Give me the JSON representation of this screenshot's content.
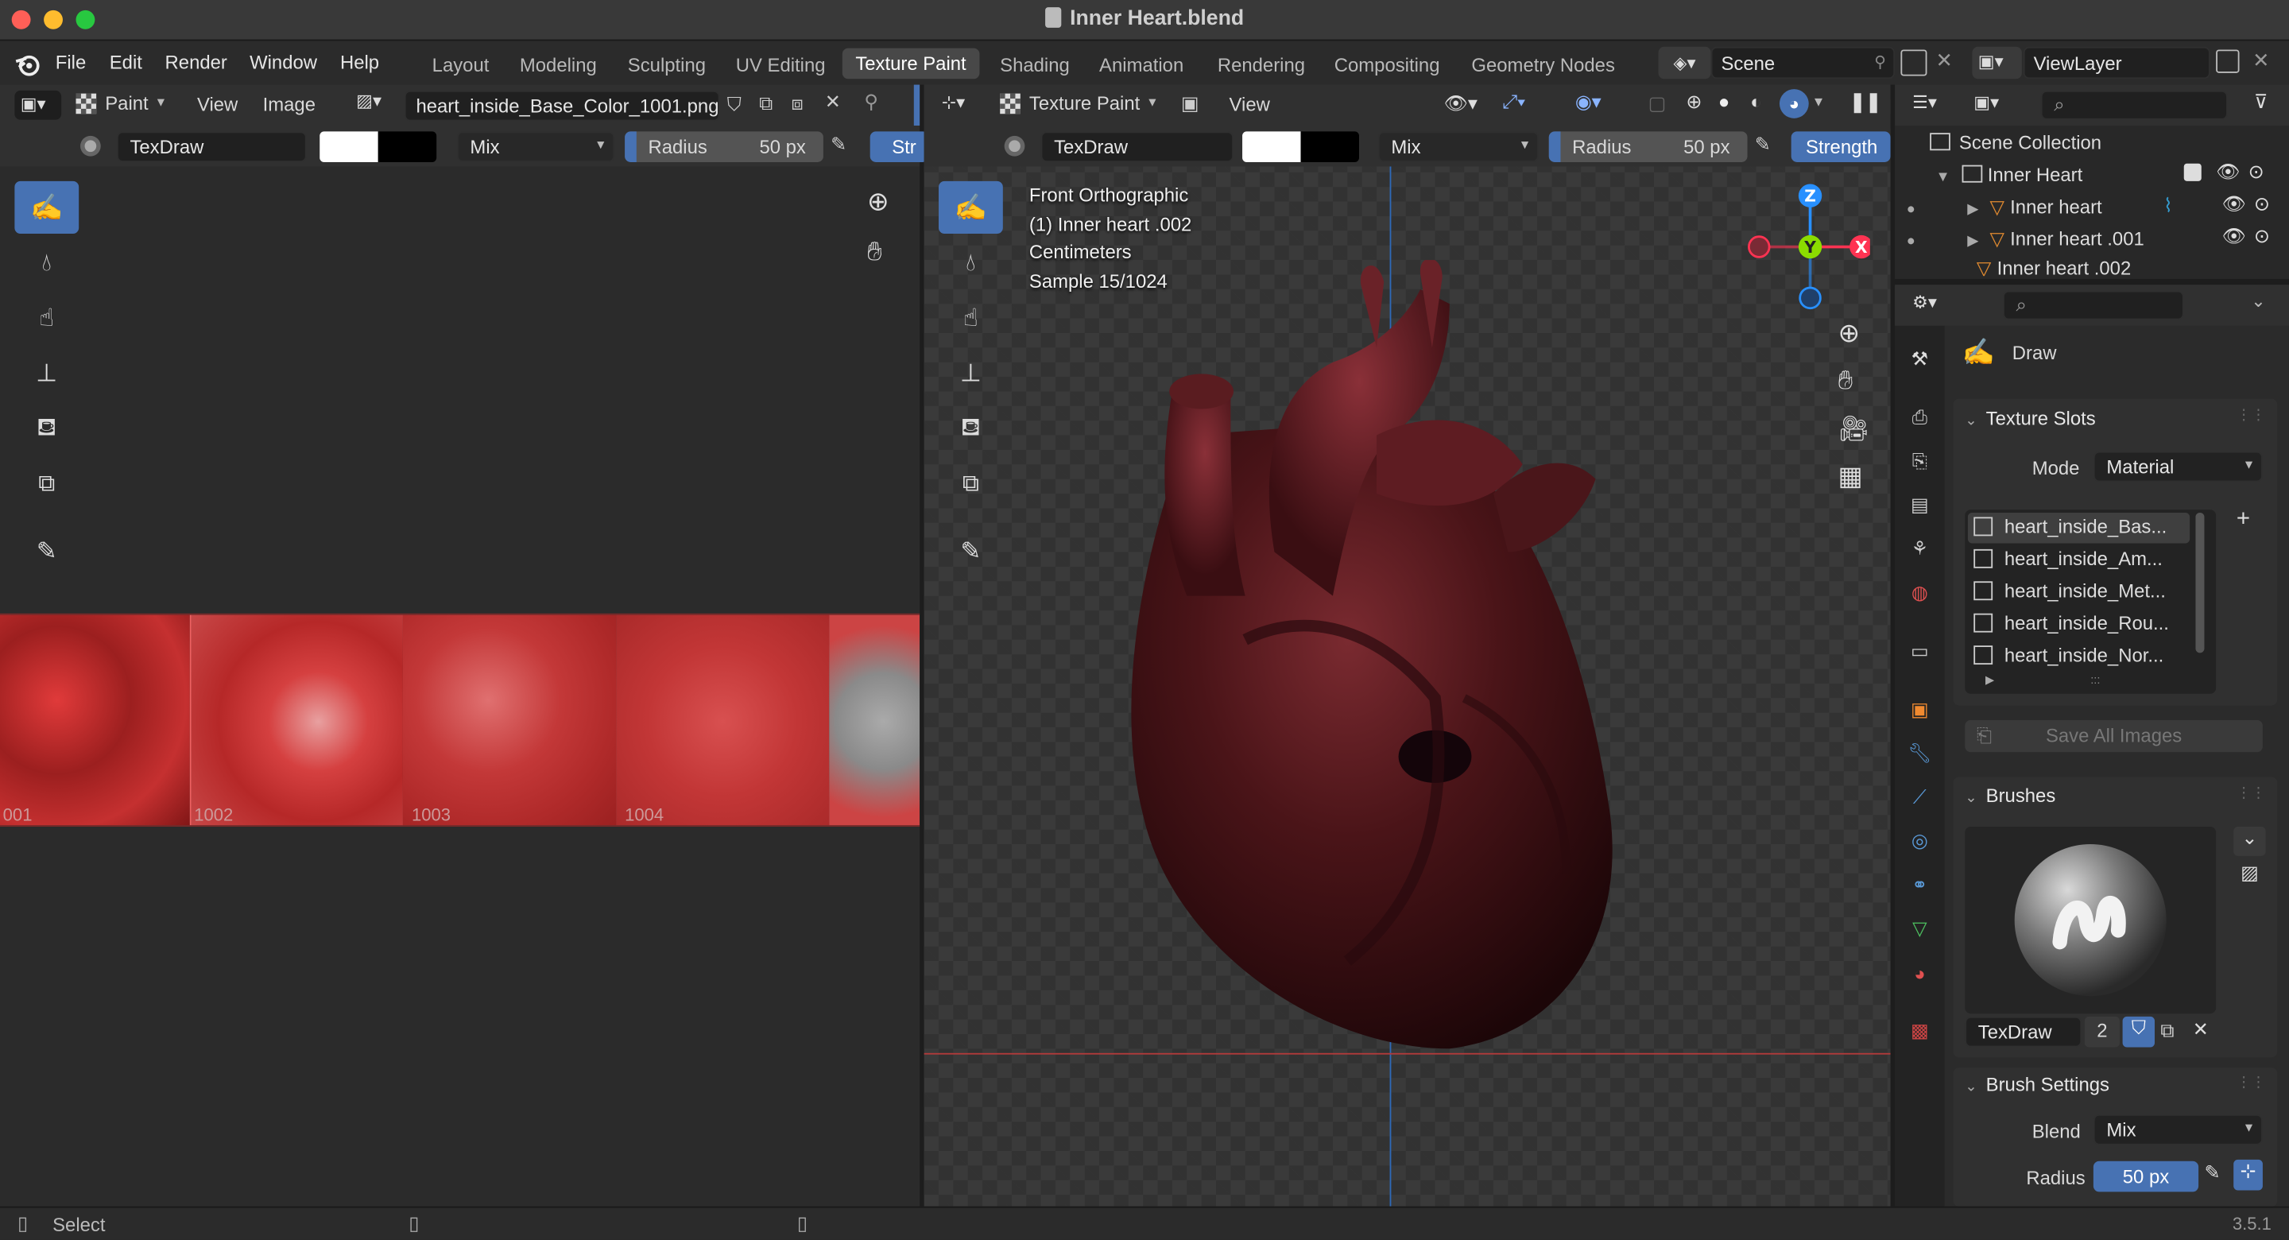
{
  "window": {
    "title": "Inner Heart.blend"
  },
  "menu": [
    "File",
    "Edit",
    "Render",
    "Window",
    "Help"
  ],
  "workspaces": [
    "Layout",
    "Modeling",
    "Sculpting",
    "UV Editing",
    "Texture Paint",
    "Shading",
    "Animation",
    "Rendering",
    "Compositing",
    "Geometry Nodes"
  ],
  "active_workspace": "Texture Paint",
  "scene": {
    "name": "Scene",
    "view_layer": "ViewLayer"
  },
  "image_editor": {
    "mode": "Paint",
    "menus": [
      "View",
      "Image"
    ],
    "image_name": "heart_inside_Base_Color_1001.png",
    "tiles": [
      "001",
      "1002",
      "1003",
      "1004"
    ]
  },
  "tool_settings": {
    "brush": "TexDraw",
    "blend": "Mix",
    "radius_label": "Radius",
    "radius_value": "50 px",
    "strength_label_short": "Str",
    "strength_label": "Strength",
    "primary_color": "#ffffff",
    "secondary_color": "#000000"
  },
  "viewport": {
    "mode": "Texture Paint",
    "menu": "View",
    "overlay_lines": [
      "Front Orthographic",
      "(1) Inner heart .002",
      "Centimeters",
      "Sample 15/1024"
    ],
    "gizmo_axes": [
      "Z",
      "Y",
      "X"
    ]
  },
  "outliner": {
    "root": "Scene Collection",
    "collection": "Inner Heart",
    "items": [
      "Inner heart",
      "Inner heart .001",
      "Inner heart .002"
    ]
  },
  "properties": {
    "tool_name": "Draw",
    "texture_slots": {
      "title": "Texture Slots",
      "mode_label": "Mode",
      "mode_value": "Material",
      "slots": [
        "heart_inside_Bas...",
        "heart_inside_Am...",
        "heart_inside_Met...",
        "heart_inside_Rou...",
        "heart_inside_Nor..."
      ],
      "save_button": "Save All Images"
    },
    "brushes": {
      "title": "Brushes",
      "brush_name": "TexDraw",
      "users": "2"
    },
    "brush_settings": {
      "title": "Brush Settings",
      "blend_label": "Blend",
      "blend_value": "Mix",
      "radius_label": "Radius",
      "radius_value": "50 px"
    }
  },
  "status_bar": {
    "left": "Select",
    "version": "3.5.1"
  },
  "colors": {
    "accent": "#4772b3",
    "x_axis": "#ff3352",
    "y_axis": "#8bdc00",
    "z_axis": "#2890ff"
  }
}
